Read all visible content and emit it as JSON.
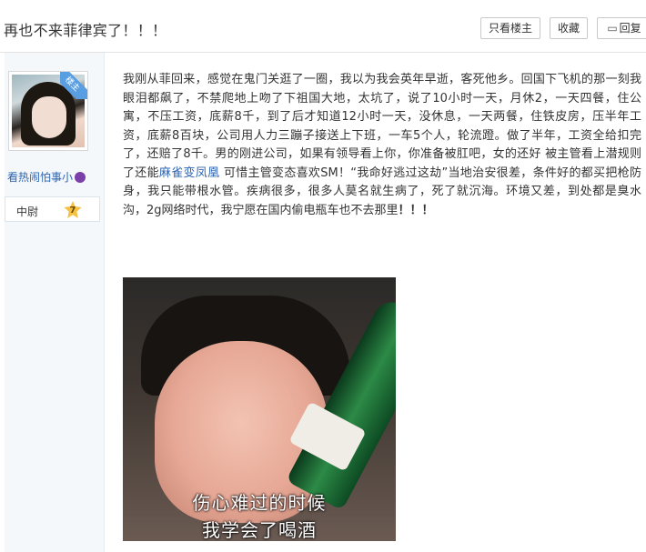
{
  "header": {
    "title": "再也不来菲律宾了！！！",
    "only_owner_label": "只看楼主",
    "favorite_label": "收藏",
    "reply_label": "回复"
  },
  "sidebar": {
    "owner_tag": "楼主",
    "username": "看热闹怕事小",
    "rank_name": "中尉",
    "rank_level": "7"
  },
  "post": {
    "segments": {
      "s1": "我刚从菲回来，感觉在鬼门关逛了一圈，我以为我会英年早逝，客死他乡。回国下飞机的那一刻我眼泪都飙了，不禁爬地上吻了下祖国大地，太坑了，说了10小时一天，月休2，一天四餐，住公寓，不压工资，底薪8千，到了后才知道12小时一天，没休息，一天两餐，住铁皮房，压半年工资，底薪8百块，公司用人力三蹦子接送上下班，一车5个人，轮流蹬。做了半年，工资全给扣完了，还赔了8千。男的刚进公司，如果有领导看上你，你准备被肛吧，女的还好 被主管看上潜规则了还能",
      "link": "麻雀变凤凰",
      "s2": " 可惜主管变态喜欢SM！“我命好逃过这劫”当地治安很差，条件好的都买把枪防身，我只能带根水管。疾病很多，很多人莫名就生病了，死了就沉海。环境又差，到处都是臭水沟，2g网络时代，我宁愿在国内偷电瓶车也不去那里",
      "end": "！！！"
    },
    "image": {
      "caption_line1": "伤心难过的时候",
      "caption_line2": "我学会了喝酒"
    }
  },
  "colors": {
    "link": "#2d64b3",
    "owner_ribbon": "#5a9ee2",
    "sidebar_bg": "#f4f8fb",
    "rank_badge": "#f5c142"
  }
}
